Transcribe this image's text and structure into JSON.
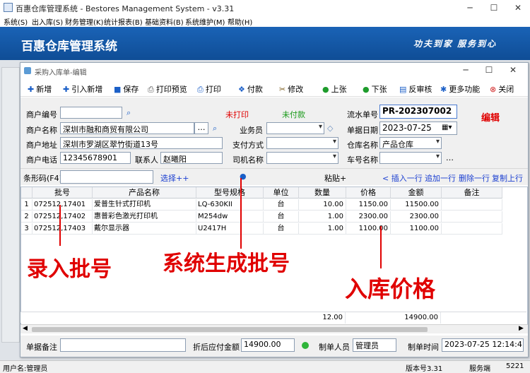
{
  "app": {
    "title": "百惠仓库管理系统 - Bestores Management System - v3.31",
    "menu": [
      "系统(S)",
      "出入库(S)",
      "财务管理(K)",
      "统计报表(B)",
      "基础资料(B)",
      "系统维护(M)",
      "帮助(H)"
    ],
    "banner_title": "百惠仓库管理系统",
    "banner_slogan": "功夫到家 服务到心"
  },
  "window": {
    "title": "采购入库单-编辑",
    "toolbar": [
      {
        "icon": "plus-icon",
        "label": "新增"
      },
      {
        "icon": "plus-icon",
        "label": "引入新增"
      },
      {
        "icon": "save-icon",
        "label": "保存"
      },
      {
        "icon": "print-preview-icon",
        "label": "打印预览"
      },
      {
        "icon": "printer-icon",
        "label": "打印"
      },
      {
        "icon": "payment-icon",
        "label": "付款"
      },
      {
        "icon": "edit-icon",
        "label": "修改"
      },
      {
        "icon": "up-icon",
        "label": "上张"
      },
      {
        "icon": "down-icon",
        "label": "下张"
      },
      {
        "icon": "unapprove-icon",
        "label": "反审核"
      },
      {
        "icon": "more-icon",
        "label": "更多功能"
      },
      {
        "icon": "close-icon",
        "label": "关闭"
      }
    ]
  },
  "form": {
    "merchant_code_label": "商户编号",
    "merchant_code": "",
    "merchant_name_label": "商户名称",
    "merchant_name": "深圳市融和商贸有限公司",
    "merchant_addr_label": "商户地址",
    "merchant_addr": "深圳市罗湖区翠竹街道13号",
    "merchant_phone_label": "商户电话",
    "merchant_phone": "12345678901",
    "contact_label": "联系人",
    "contact": "赵曦阳",
    "unprinted": "未打印",
    "unpaid": "未付款",
    "salesman_label": "业务员",
    "salesman": "",
    "pay_method_label": "支付方式",
    "pay_method": "",
    "driver_label": "司机名称",
    "driver": "",
    "serial_label": "流水单号",
    "serial": "PR-202307002",
    "date_label": "单据日期",
    "date": "2023-07-25",
    "warehouse_label": "仓库名称",
    "warehouse": "产品仓库",
    "plate_label": "车号名称",
    "plate": "",
    "edit_mark": "编辑"
  },
  "barcode": {
    "label": "条形码(F4)",
    "value": "",
    "select": "选择++",
    "paste": "粘贴+",
    "insert_row": "< 插入一行",
    "append_row": "追加一行",
    "delete_row": "删除一行",
    "copy_row": "复制上行"
  },
  "table": {
    "columns": [
      "批号",
      "产品名称",
      "型号规格",
      "单位",
      "数量",
      "价格",
      "金额",
      "备注"
    ],
    "rows": [
      {
        "no": "1",
        "batch": "072512,17401",
        "name": "爱普生针式打印机",
        "model": "LQ-630KII",
        "unit": "台",
        "qty": "10.00",
        "price": "1150.00",
        "amount": "11500.00",
        "note": ""
      },
      {
        "no": "2",
        "batch": "072512,17402",
        "name": "惠普彩色激光打印机",
        "model": "M254dw",
        "unit": "台",
        "qty": "1.00",
        "price": "2300.00",
        "amount": "2300.00",
        "note": ""
      },
      {
        "no": "3",
        "batch": "072512,17403",
        "name": "戴尔显示器",
        "model": "U2417H",
        "unit": "台",
        "qty": "1.00",
        "price": "1100.00",
        "amount": "1100.00",
        "note": ""
      }
    ],
    "total_qty": "12.00",
    "total_amount": "14900.00"
  },
  "footer": {
    "remark_label": "单据备注",
    "remark": "",
    "discount_label": "折后应付金额",
    "discount": "14900.00",
    "maker_label": "制单人员",
    "maker": "管理员",
    "make_time_label": "制单时间",
    "make_time": "2023-07-25 12:14:41"
  },
  "annotations": {
    "a1": "录入批号",
    "a2": "系统生成批号",
    "a3": "入库价格"
  },
  "statusbar": {
    "user": "用户名:管理员",
    "version": "版本号3.31",
    "service": "服务端",
    "code": "5221"
  }
}
